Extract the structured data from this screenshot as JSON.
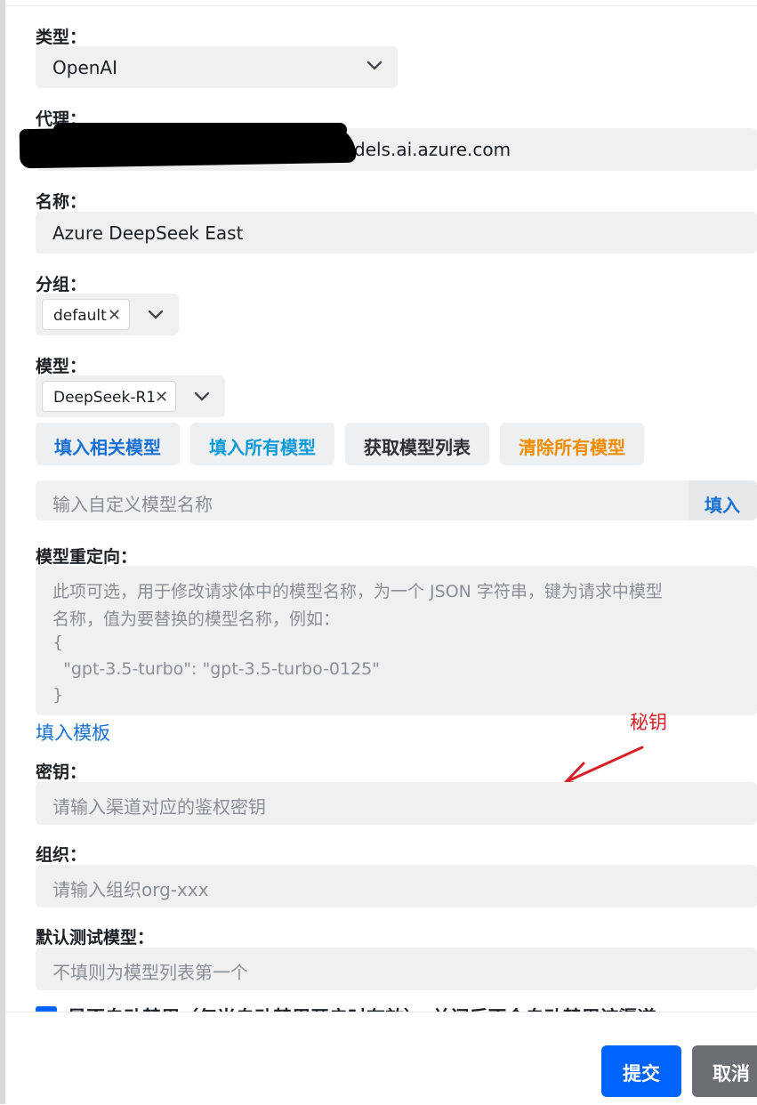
{
  "type": {
    "label": "类型：",
    "value": "OpenAI"
  },
  "proxy": {
    "label": "代理：",
    "value_visible": "dels.ai.azure.com"
  },
  "name": {
    "label": "名称：",
    "value": "Azure DeepSeek East"
  },
  "group": {
    "label": "分组：",
    "tag": "default"
  },
  "model": {
    "label": "模型：",
    "tag": "DeepSeek-R1"
  },
  "model_buttons": {
    "fill_related": "填入相关模型",
    "fill_all": "填入所有模型",
    "fetch_list": "获取模型列表",
    "clear_all": "清除所有模型"
  },
  "custom_model": {
    "placeholder": "输入自定义模型名称",
    "fill_button": "填入"
  },
  "model_mapping": {
    "label": "模型重定向：",
    "placeholder_line1": "此项可选，用于修改请求体中的模型名称，为一个 JSON 字符串，键为请求中模型",
    "placeholder_line2": "名称，值为要替换的模型名称，例如：",
    "placeholder_line3": "{",
    "placeholder_line4": "  \"gpt-3.5-turbo\": \"gpt-3.5-turbo-0125\"",
    "placeholder_line5": "}",
    "template_link": "填入模板"
  },
  "annotation": {
    "text": "秘钥",
    "color": "#d62027"
  },
  "key": {
    "label": "密钥：",
    "placeholder": "请输入渠道对应的鉴权密钥"
  },
  "org": {
    "label": "组织：",
    "placeholder": "请输入组织org-xxx"
  },
  "test_model": {
    "label": "默认测试模型：",
    "placeholder": "不填则为模型列表第一个"
  },
  "auto_ban": {
    "text": "是否自动禁用（仅当自动禁用开启时有效），关闭后不会自动禁用该渠道："
  },
  "footer": {
    "submit": "提交",
    "cancel": "取消"
  },
  "colors": {
    "primary": "#0064fa",
    "link_blue": "#1971d6",
    "cyan": "#0e9bd8",
    "orange": "#f08c00",
    "cancel_gray": "#6b6e72"
  }
}
